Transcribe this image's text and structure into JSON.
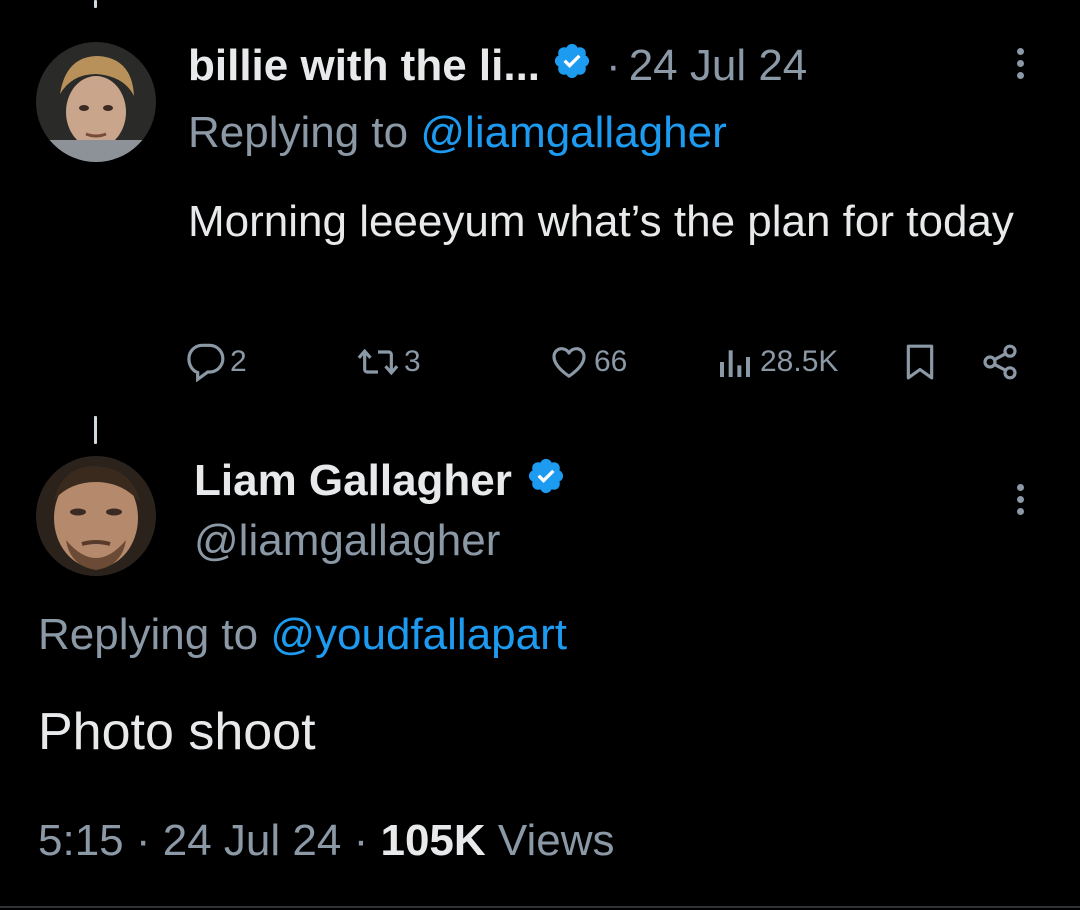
{
  "reply_tweet": {
    "display_name": "billie with the li...",
    "verified": true,
    "separator": "·",
    "date": "24 Jul 24",
    "replying_prefix": "Replying to",
    "replying_handle": "@liamgallagher",
    "text": "Morning leeeyum what’s the plan for today",
    "actions": {
      "replies": "2",
      "reposts": "3",
      "likes": "66",
      "views": "28.5K"
    }
  },
  "main_tweet": {
    "display_name": "Liam Gallagher",
    "verified": true,
    "handle": "@liamgallagher",
    "replying_prefix": "Replying to",
    "replying_handle": "@youdfallapart",
    "text": "Photo shoot",
    "time": "5:15",
    "sep1": "·",
    "date": "24 Jul 24",
    "sep2": "·",
    "views_count": "105K",
    "views_label": "Views"
  },
  "colors": {
    "background": "#000000",
    "text": "#e7e9ea",
    "muted": "#8b98a5",
    "link": "#1d9bf0",
    "verified_badge": "#1d9bf0"
  },
  "icons": [
    "verified-badge-icon",
    "more-icon",
    "reply-icon",
    "repost-icon",
    "like-icon",
    "views-icon",
    "bookmark-icon",
    "share-icon"
  ]
}
